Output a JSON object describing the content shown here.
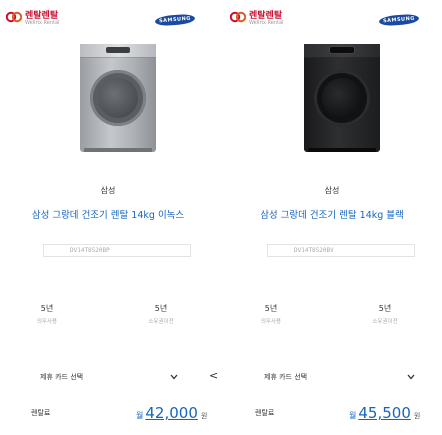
{
  "brand_logo": {
    "name": "렌탈렌탈",
    "sub": "Wellrix Rental"
  },
  "manufacturer_logo": "SAMSUNG",
  "products": [
    {
      "color": "silver",
      "brand": "삼성",
      "title": "삼성 그랑데 건조기 렌탈 14kg 이녹스",
      "model": "DV14T8520BP",
      "options": [
        {
          "value": "5년",
          "label": "의무사용"
        },
        {
          "value": "5년",
          "label": "소유권이전"
        }
      ],
      "card_select": "제휴 카드 선택",
      "price_label": "렌탈료",
      "price_prefix": "월",
      "price": "42,000",
      "price_unit": "원"
    },
    {
      "color": "black",
      "brand": "삼성",
      "title": "삼성 그랑데 건조기 렌탈 14kg 블랙",
      "model": "DV14T8520BV",
      "options": [
        {
          "value": "5년",
          "label": "의무사용"
        },
        {
          "value": "5년",
          "label": "소유권이전"
        }
      ],
      "card_select": "제휴 카드 선택",
      "price_label": "렌탈료",
      "price_prefix": "월",
      "price": "45,500",
      "price_unit": "원"
    }
  ],
  "nav_prev_glyph": "<"
}
